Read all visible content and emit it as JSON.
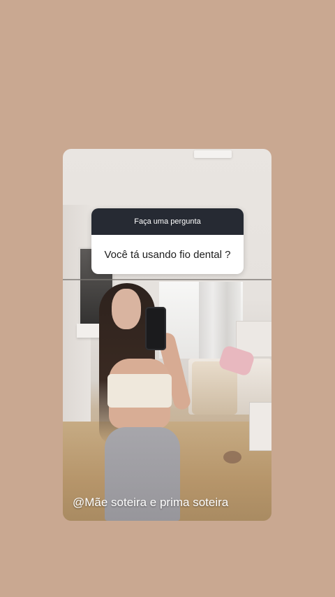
{
  "story": {
    "background_color": "#c9a891",
    "question_sticker": {
      "header": "Faça uma pergunta",
      "question": "Você tá usando fio dental ?",
      "header_color": "#262a33"
    },
    "caption": "@Mãe soteira e prima soteira"
  }
}
